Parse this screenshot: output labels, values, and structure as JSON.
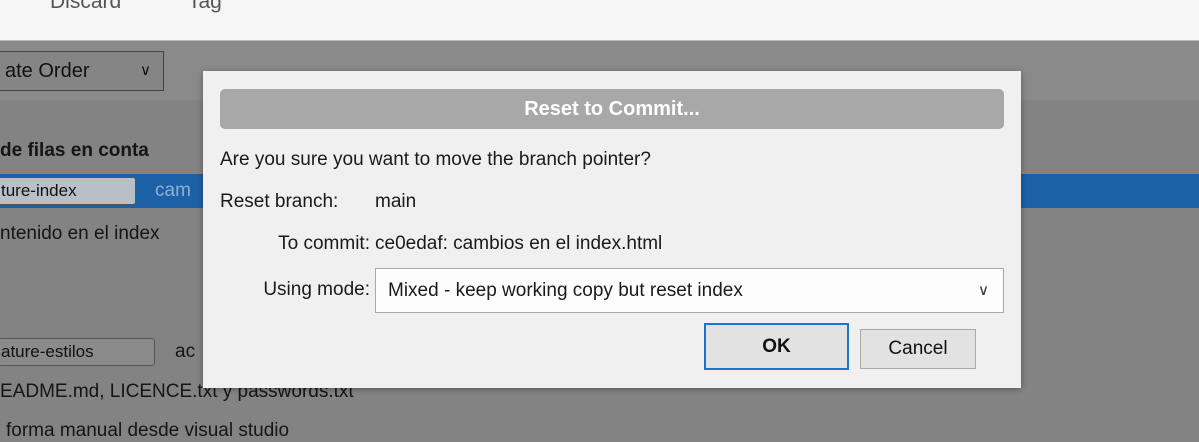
{
  "toolbar": {
    "discard_label": "Discard",
    "tag_label": "Tag"
  },
  "sort_select": {
    "value": "ate Order"
  },
  "background": {
    "heading": "de filas en conta",
    "rows": [
      {
        "branch": "ture-index",
        "message": "cam"
      },
      {
        "text": "ntenido en el index"
      },
      {
        "branch": "ature-estilos",
        "message": "ac"
      },
      {
        "text": "EADME.md, LICENCE.txt y passwords.txt"
      },
      {
        "text": "forma manual desde visual studio"
      }
    ]
  },
  "dialog": {
    "title": "Reset to Commit...",
    "question": "Are you sure you want to move the branch pointer?",
    "reset_branch_label": "Reset branch:",
    "reset_branch_value": "main",
    "to_commit_label": "To commit:",
    "to_commit_value": "ce0edaf: cambios en el index.html",
    "using_mode_label": "Using mode:",
    "using_mode_value": "Mixed - keep working copy but reset index",
    "ok_label": "OK",
    "cancel_label": "Cancel"
  },
  "icons": {
    "dropdown": "chevron-down-icon"
  }
}
